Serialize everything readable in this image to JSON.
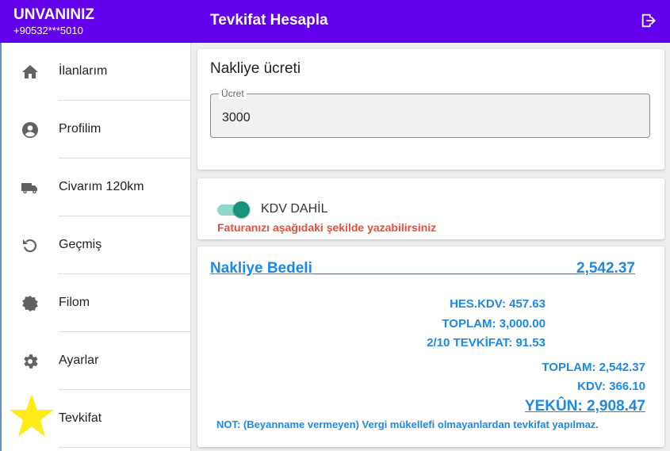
{
  "header": {
    "brand_name": "UNVANINIZ",
    "phone": "+90532***5010",
    "title": "Tevkifat Hesapla",
    "logout_icon": "logout-icon",
    "color": "#6200ee"
  },
  "sidebar": {
    "items": [
      {
        "label": "İlanlarım",
        "icon": "home-icon"
      },
      {
        "label": "Profilim",
        "icon": "account-circle-icon"
      },
      {
        "label": "Civarım 120km",
        "icon": "truck-icon"
      },
      {
        "label": "Geçmiş",
        "icon": "history-icon"
      },
      {
        "label": "Filom",
        "icon": "badge-icon"
      },
      {
        "label": "Ayarlar",
        "icon": "gear-icon"
      },
      {
        "label": "Tevkifat",
        "icon": "star-icon"
      }
    ]
  },
  "price": {
    "title": "Nakliye ücreti",
    "field_label": "Ücret",
    "value": "3000"
  },
  "vat": {
    "toggle_label": "KDV DAHİL",
    "toggle_on": true,
    "note": "Faturanızı aşağıdaki şekilde yazabilirsiniz"
  },
  "result": {
    "bedeli_label": "Nakliye Bedeli________________________________",
    "bedeli_value": "2,542.37",
    "hes_kdv": "HES.KDV: 457.63",
    "toplam1": "TOPLAM: 3,000.00",
    "tevkifat": "2/10 TEVKİFAT: 91.53",
    "toplam2": "TOPLAM: 2,542.37",
    "kdv": "KDV: 366.10",
    "yekun": "YEKÛN: 2,908.47",
    "note": "NOT: (Beyanname vermeyen) Vergi mükellefi olmayanlardan tevkifat yapılmaz."
  },
  "colors": {
    "accent_blue": "#1e88e5",
    "warning_red": "#e3503e",
    "toggle_teal": "#18947e",
    "star_yellow": "#ffeb1a"
  }
}
